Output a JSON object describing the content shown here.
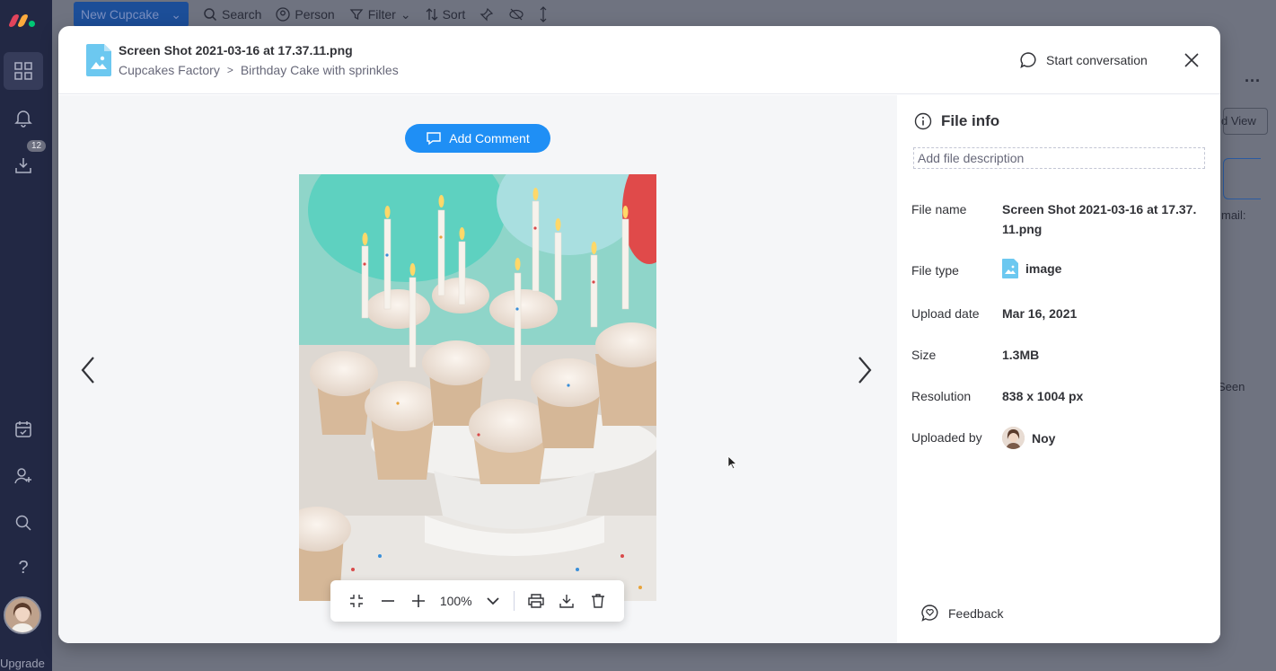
{
  "background": {
    "toolbar": {
      "new_item_label": "New Cupcake",
      "search_label": "Search",
      "person_label": "Person",
      "filter_label": "Filter",
      "sort_label": "Sort"
    },
    "sidebar": {
      "notification_count": "12",
      "upgrade_label": "Upgrade"
    },
    "right_fragments": {
      "view_label": "d View",
      "email_label": "mail:",
      "seen_label": "Seen"
    }
  },
  "modal": {
    "file_title": "Screen Shot 2021-03-16 at 17.37.11.png",
    "breadcrumb": [
      "Cupcakes Factory",
      "Birthday Cake with sprinkles"
    ],
    "start_conversation_label": "Start conversation",
    "add_comment_label": "Add Comment",
    "zoom_level": "100%",
    "info": {
      "heading": "File info",
      "description_placeholder": "Add file description",
      "rows": [
        {
          "label": "File name",
          "value": "Screen Shot 2021-03-16 at 17.37.11.png"
        },
        {
          "label": "File type",
          "value": "image"
        },
        {
          "label": "Upload date",
          "value": "Mar 16, 2021"
        },
        {
          "label": "Size",
          "value": "1.3MB"
        },
        {
          "label": "Resolution",
          "value": "838 x 1004 px"
        },
        {
          "label": "Uploaded by",
          "value": "Noy"
        }
      ]
    },
    "feedback_label": "Feedback"
  },
  "colors": {
    "primary": "#1f8ff5",
    "sidebar": "#222844",
    "file_icon": "#6cc8f0"
  },
  "icons": [
    "grid-icon",
    "bell-icon",
    "download-icon",
    "calendar-icon",
    "add-person-icon",
    "search-icon",
    "help-icon",
    "chat-icon",
    "close-icon",
    "info-icon",
    "chevron-left-icon",
    "chevron-right-icon",
    "collapse-icon",
    "minus-icon",
    "plus-icon",
    "chevron-down-icon",
    "print-icon",
    "trash-icon",
    "feedback-icon"
  ]
}
